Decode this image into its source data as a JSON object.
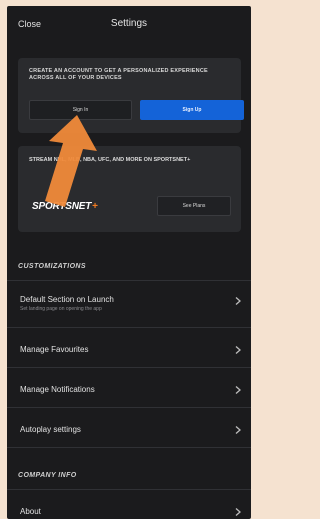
{
  "header": {
    "close_label": "Close",
    "title": "Settings"
  },
  "account_card": {
    "promo": "CREATE AN ACCOUNT TO GET A PERSONALIZED EXPERIENCE ACROSS ALL OF YOUR DEVICES",
    "sign_in_label": "Sign In",
    "sign_up_label": "Sign Up"
  },
  "promo_card": {
    "headline": "STREAM NHL, MLB, NBA, UFC, AND MORE ON SPORTSNET+",
    "logo_text": "SPORTSNET",
    "logo_plus": "+",
    "plans_label": "See Plans"
  },
  "customizations": {
    "header": "CUSTOMIZATIONS",
    "items": [
      {
        "label": "Default Section on Launch",
        "sub": "Set landing page on opening the app"
      },
      {
        "label": "Manage Favourites",
        "sub": ""
      },
      {
        "label": "Manage Notifications",
        "sub": ""
      },
      {
        "label": "Autoplay settings",
        "sub": ""
      }
    ]
  },
  "company_info": {
    "header": "COMPANY INFO",
    "items": [
      {
        "label": "About",
        "sub": ""
      }
    ]
  },
  "colors": {
    "background": "#1b1b1d",
    "card": "#2a2b2e",
    "accent_blue": "#1463d8",
    "brand_orange": "#f47b20"
  }
}
